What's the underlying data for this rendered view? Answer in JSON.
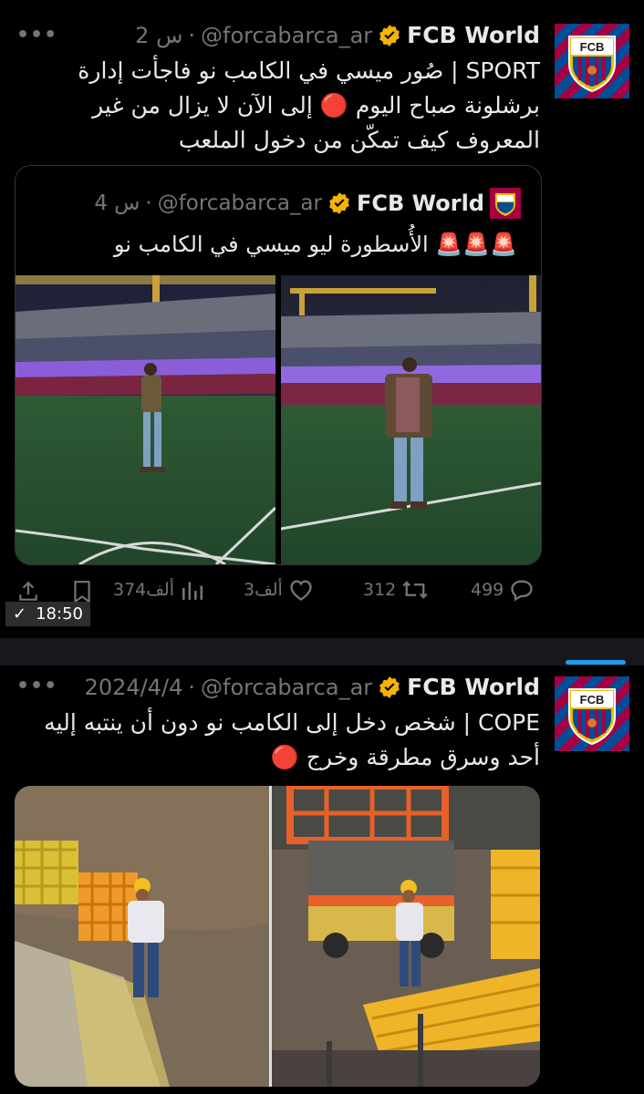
{
  "tweet1": {
    "account_name": "FCB World",
    "handle": "@forcabarca_ar",
    "time": "2 س",
    "body_lines": [
      "SPORT | صُور ميسي في الكامب نو فاجأت إدارة",
      "برشلونة صباح اليوم 🔴 إلى الآن لا يزال من غير",
      "المعروف كيف تمكّن من دخول الملعب"
    ],
    "quoted": {
      "account_name": "FCB World",
      "handle": "@forcabarca_ar",
      "time": "4 س",
      "text": "🚨🚨🚨 الأُسطورة ليو ميسي في الكامب نو"
    },
    "stats": {
      "replies": "499",
      "reposts": "312",
      "likes": "3ألف",
      "views": "374ألف"
    },
    "toast_time": "18:50"
  },
  "tweet2": {
    "account_name": "FCB World",
    "handle": "@forcabarca_ar",
    "time": "2024/4/4",
    "body_lines": [
      "COPE | شخص دخل إلى الكامب نو دون أن ينتبه إليه",
      "أحد وسرق مطرقة وخرج 🔴"
    ]
  },
  "avatar_text": "FCB",
  "colors": {
    "accent": "#1d9bf0",
    "verified": "#f4b400",
    "background": "#000000"
  },
  "icons": [
    "more-icon",
    "verified-badge-icon",
    "reply-icon",
    "repost-icon",
    "like-icon",
    "views-icon",
    "bookmark-icon",
    "share-icon",
    "check-icon"
  ]
}
